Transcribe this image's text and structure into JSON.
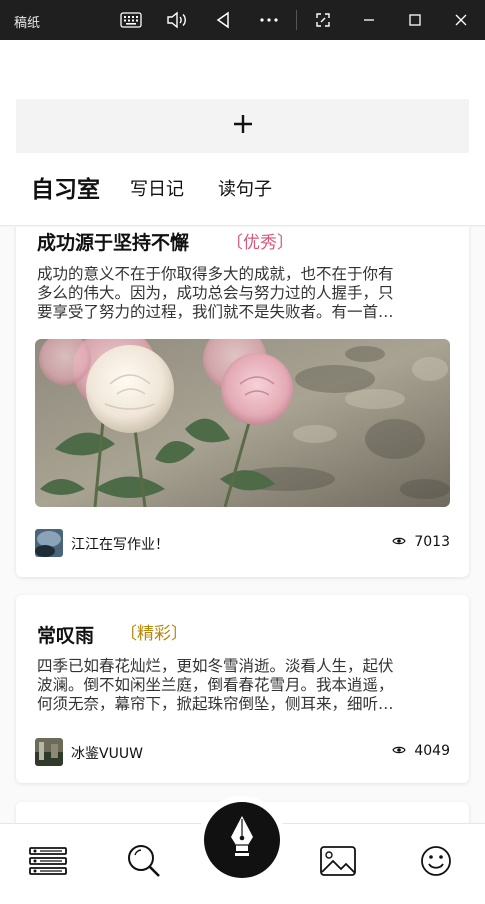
{
  "window": {
    "title": "稿纸"
  },
  "add_bar": {
    "label": "+"
  },
  "tabs": [
    {
      "label": "自习室",
      "active": true
    },
    {
      "label": "写日记",
      "active": false
    },
    {
      "label": "读句子",
      "active": false
    }
  ],
  "posts": [
    {
      "title": "成功源于坚持不懈",
      "badge": "〔优秀〕",
      "excerpt": [
        "成功的意义不在于你取得多大的成就，也不在于你有",
        "多么的伟大。因为，成功总会与努力过的人握手，只",
        "要享受了努力的过程，我们就不是失败者。有一首…"
      ],
      "image": "rose-photo",
      "author": "江江在写作业！",
      "views": "7013"
    },
    {
      "title": "常叹雨",
      "badge": "〔精彩〕",
      "excerpt": [
        "四季已如春花灿烂，更如冬雪消逝。淡看人生，起伏",
        "波澜。倒不如闲坐兰庭，倒看春花雪月。我本逍遥，",
        "何须无奈，幕帘下，掀起珠帘倒坠，侧耳来，细听…"
      ],
      "author": "冰鉴VUUW",
      "views": "4049"
    }
  ],
  "nav": [
    "list-icon",
    "search-icon",
    "pen-nib-icon",
    "image-icon",
    "smiley-icon"
  ],
  "colors": {
    "badge_excellent": "#d9577a",
    "badge_wonderful": "#b8860b",
    "titlebar": "#1f1f1f"
  }
}
